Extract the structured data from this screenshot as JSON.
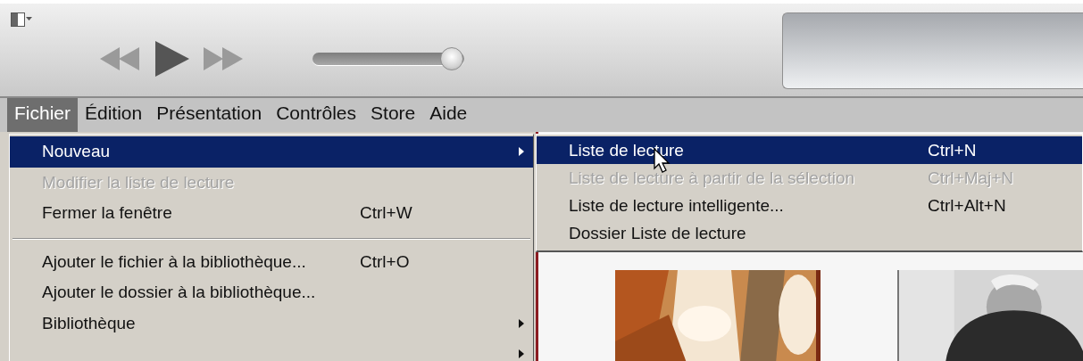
{
  "toolbar": {
    "volume": {
      "level": 0.92
    }
  },
  "menu_bar": [
    {
      "label": "Fichier",
      "selected": true
    },
    {
      "label": "Édition",
      "selected": false
    },
    {
      "label": "Présentation",
      "selected": false
    },
    {
      "label": "Contrôles",
      "selected": false
    },
    {
      "label": "Store",
      "selected": false
    },
    {
      "label": "Aide",
      "selected": false
    }
  ],
  "menu": {
    "items": [
      {
        "kind": "item",
        "label": "Nouveau",
        "selected": true,
        "disabled": false,
        "submenu": true
      },
      {
        "kind": "item",
        "label": "Modifier la liste de lecture",
        "selected": false,
        "disabled": true,
        "submenu": false
      },
      {
        "kind": "item",
        "label": "Fermer la fenêtre",
        "shortcut": "Ctrl+W",
        "selected": false,
        "disabled": false,
        "submenu": false
      },
      {
        "kind": "separator"
      },
      {
        "kind": "item",
        "label": "Ajouter le fichier à la bibliothèque...",
        "shortcut": "Ctrl+O",
        "selected": false,
        "disabled": false,
        "submenu": false
      },
      {
        "kind": "item",
        "label": "Ajouter le dossier à la bibliothèque...",
        "selected": false,
        "disabled": false,
        "submenu": false
      },
      {
        "kind": "item",
        "label": "Bibliothèque",
        "selected": false,
        "disabled": false,
        "submenu": true
      },
      {
        "kind": "item",
        "selected": false,
        "submenu": true
      }
    ]
  },
  "submenu": {
    "items": [
      {
        "kind": "item",
        "label": "Liste de lecture",
        "shortcut": "Ctrl+N",
        "selected": true,
        "disabled": false
      },
      {
        "kind": "item",
        "label": "Liste de lecture à partir de la sélection",
        "shortcut": "Ctrl+Maj+N",
        "selected": false,
        "disabled": true
      },
      {
        "kind": "item",
        "label": "Liste de lecture intelligente...",
        "shortcut": "Ctrl+Alt+N",
        "selected": false,
        "disabled": false
      },
      {
        "kind": "item",
        "label": "Dossier Liste de lecture",
        "selected": false,
        "disabled": false
      }
    ]
  }
}
